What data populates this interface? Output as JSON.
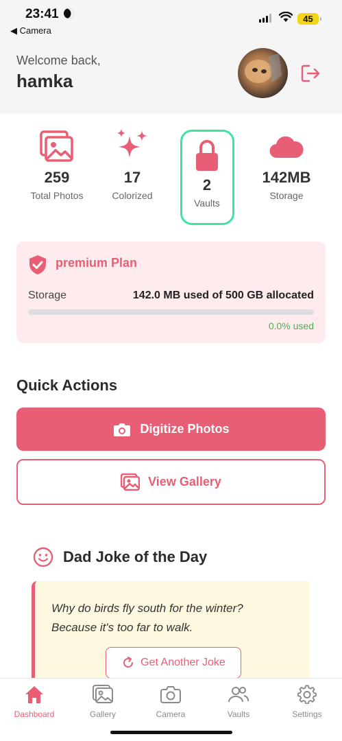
{
  "status_bar": {
    "time": "23:41",
    "back_label": "◀ Camera",
    "battery": "45"
  },
  "header": {
    "welcome": "Welcome back,",
    "username": "hamka"
  },
  "stats": [
    {
      "icon": "photos-icon",
      "value": "259",
      "label": "Total Photos"
    },
    {
      "icon": "sparkles-icon",
      "value": "17",
      "label": "Colorized"
    },
    {
      "icon": "lock-icon",
      "value": "2",
      "label": "Vaults"
    },
    {
      "icon": "cloud-icon",
      "value": "142MB",
      "label": "Storage"
    }
  ],
  "plan": {
    "title": "premium Plan",
    "storage_label": "Storage",
    "usage_text": "142.0 MB used of 500 GB allocated",
    "used_fraction": 0.0,
    "percent_text": "0.0% used"
  },
  "quick_actions": {
    "title": "Quick Actions",
    "digitize_label": "Digitize Photos",
    "gallery_label": "View Gallery"
  },
  "joke": {
    "title": "Dad Joke of the Day",
    "text_line1": "Why do birds fly south for the winter?",
    "text_line2": "Because it's too far to walk.",
    "button_label": "Get Another Joke"
  },
  "tabs": [
    {
      "label": "Dashboard",
      "icon": "home-icon",
      "active": true
    },
    {
      "label": "Gallery",
      "icon": "gallery-icon",
      "active": false
    },
    {
      "label": "Camera",
      "icon": "camera-icon",
      "active": false
    },
    {
      "label": "Vaults",
      "icon": "users-icon",
      "active": false
    },
    {
      "label": "Settings",
      "icon": "gear-icon",
      "active": false
    }
  ],
  "colors": {
    "accent": "#e85e74",
    "highlight_border": "#3ee3a1",
    "success": "#4caf50",
    "plan_bg": "#fdebee",
    "joke_bg": "#fff8e1"
  }
}
